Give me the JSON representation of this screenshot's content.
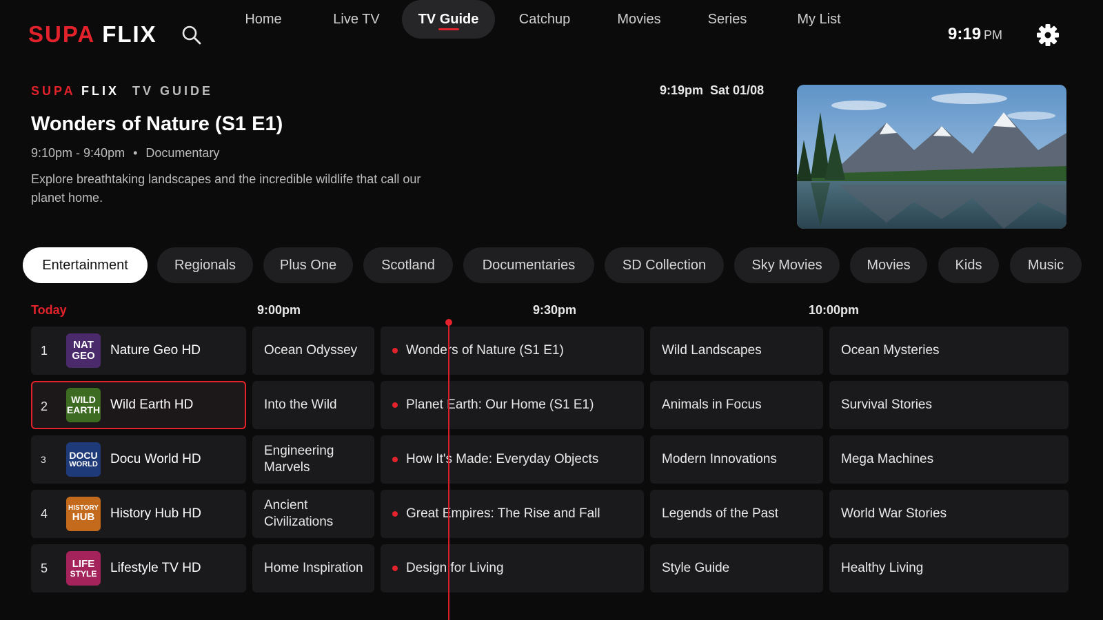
{
  "brand": {
    "part1": "SUPA",
    "part2": "FLIX"
  },
  "nav": {
    "items": [
      {
        "label": "Home"
      },
      {
        "label": "Live TV"
      },
      {
        "label": "TV Guide",
        "active": true
      },
      {
        "label": "Catchup"
      },
      {
        "label": "Movies"
      },
      {
        "label": "Series"
      },
      {
        "label": "My List"
      }
    ]
  },
  "clock": {
    "time": "9:19",
    "ampm": "PM"
  },
  "hero": {
    "brand_red": "SUPA",
    "brand_white": "FLIX",
    "section": "TV GUIDE",
    "datetime": "9:19pm  Sat 01/08",
    "title": "Wonders of Nature (S1 E1)",
    "time_range": "9:10pm - 9:40pm",
    "separator": "•",
    "genre": "Documentary",
    "description": "Explore breathtaking landscapes and the incredible wildlife that call our planet home."
  },
  "categories": [
    {
      "label": "Entertainment",
      "active": true
    },
    {
      "label": "Regionals"
    },
    {
      "label": "Plus One"
    },
    {
      "label": "Scotland"
    },
    {
      "label": "Documentaries"
    },
    {
      "label": "SD Collection"
    },
    {
      "label": "Sky Movies"
    },
    {
      "label": "Movies"
    },
    {
      "label": "Kids"
    },
    {
      "label": "Music"
    }
  ],
  "guide": {
    "today": "Today",
    "times": [
      "9:00pm",
      "9:30pm",
      "10:00pm"
    ],
    "channels": [
      {
        "number": "1",
        "name": "Nature Geo HD",
        "logo_line1": "NAT",
        "logo_line2": "GEO",
        "logo_color": "#4a2a6a",
        "programs": [
          "Ocean Odyssey",
          "Wonders of Nature (S1 E1)",
          "Wild Landscapes",
          "Ocean Mysteries"
        ]
      },
      {
        "number": "2",
        "name": "Wild Earth HD",
        "logo_line1": "WILD",
        "logo_line2": "EARTH",
        "logo_color": "#3d6b22",
        "selected": true,
        "programs": [
          "Into the Wild",
          "Planet Earth: Our Home (S1 E1)",
          "Animals in Focus",
          "Survival Stories"
        ]
      },
      {
        "number": "3",
        "name": "Docu World HD",
        "logo_line1": "DOCU",
        "logo_line2": "WORLD",
        "logo_color": "#1f3a78",
        "programs": [
          "Engineering Marvels",
          "How It's Made: Everyday Objects",
          "Modern Innovations",
          "Mega Machines"
        ]
      },
      {
        "number": "4",
        "name": "History Hub HD",
        "logo_line1": "HISTORY",
        "logo_line2": "HUB",
        "logo_color": "#c46a1c",
        "programs": [
          "Ancient Civilizations",
          "Great Empires: The Rise and Fall",
          "Legends of the Past",
          "World War Stories"
        ]
      },
      {
        "number": "5",
        "name": "Lifestyle TV HD",
        "logo_line1": "LIFE",
        "logo_line2": "STYLE",
        "logo_color": "#a3235a",
        "programs": [
          "Home Inspiration",
          "Design for Living",
          "Style Guide",
          "Healthy Living"
        ]
      }
    ]
  },
  "colors": {
    "accent": "#e3222b",
    "background": "#0b0b0c",
    "tile": "#1a1a1c"
  }
}
